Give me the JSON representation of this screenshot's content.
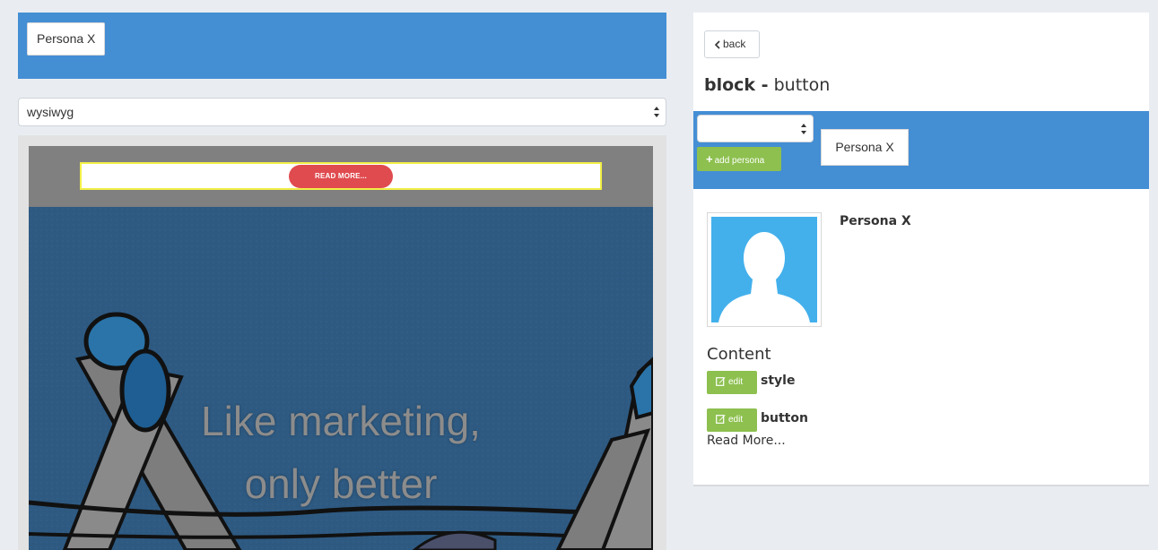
{
  "left": {
    "persona_chip": "Persona X",
    "mode_select": {
      "value": "wysiwyg"
    }
  },
  "preview": {
    "button_text": "READ MORE...",
    "hero_line1": "Like marketing,",
    "hero_line2": "only better"
  },
  "right": {
    "back_label": "back",
    "title_bold": "block -",
    "title_rest": "button",
    "add_persona_label": "add persona",
    "persona_chip": "Persona X",
    "persona_name": "Persona X",
    "content_heading": "Content",
    "fields": [
      {
        "edit_label": "edit",
        "name": "style"
      },
      {
        "edit_label": "edit",
        "name": "button",
        "value": "Read More..."
      }
    ]
  },
  "colors": {
    "header_blue": "#448ed4",
    "action_green": "#8dc04f",
    "cta_red": "#e04b4f",
    "highlight_yellow": "#f2ef46",
    "avatar_blue": "#43b0ec"
  },
  "icons": [
    "chevron-down-icon",
    "chevron-left-icon",
    "plus-icon",
    "edit-icon",
    "user-silhouette-icon"
  ]
}
